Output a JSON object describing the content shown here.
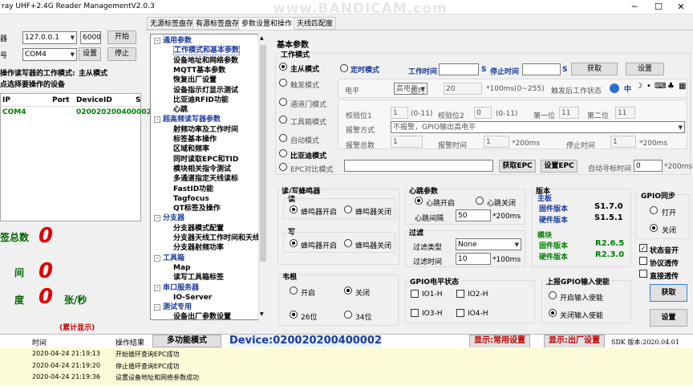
{
  "window": {
    "title": "ray UHF+2.4G Reader ManagementV2.0.3",
    "watermark": "www.BANDICAM.com"
  },
  "left": {
    "ip_label": "器",
    "ip_value": "127.0.0.1",
    "port_value": "6000",
    "start_btn": "开始",
    "com_label": "号",
    "com_value": "COM4",
    "set_btn": "设置",
    "stop_btn": "停止",
    "mode_label": "操作读写器的工作模式:",
    "mode_value": "主从模式",
    "select_hint": "点选择要操作的设备",
    "table_headers": [
      "IP",
      "Port",
      "DeviceID",
      "S"
    ],
    "table_rows": [
      [
        "COM4",
        "",
        "020020200400002",
        ""
      ]
    ],
    "count_label": "签总数",
    "count_value": "0",
    "time_label": "间",
    "time_value": "0",
    "speed_label": "度",
    "speed_value": "0",
    "speed_unit": "张/秒",
    "accum": "(累计显示)"
  },
  "tabs": [
    "无源标签盘存",
    "有源标签盘存",
    "参数设置和操作",
    "天线匹配度"
  ],
  "tree": [
    {
      "t": "通用参数",
      "k": "cat"
    },
    {
      "t": "工作模式和基本参数",
      "k": "sel"
    },
    {
      "t": "设备地址和网络参数",
      "k": "leaf"
    },
    {
      "t": "MQTT基本参数",
      "k": "leaf"
    },
    {
      "t": "恢复出厂设置",
      "k": "leaf"
    },
    {
      "t": "设备指示灯显示测试",
      "k": "leaf"
    },
    {
      "t": "比亚迪RFID功能",
      "k": "leaf"
    },
    {
      "t": "心跳",
      "k": "leaf"
    },
    {
      "t": "超高频读写器参数",
      "k": "cat"
    },
    {
      "t": "射频功率及工作时间",
      "k": "leaf"
    },
    {
      "t": "标签基本操作",
      "k": "leaf"
    },
    {
      "t": "区域和频率",
      "k": "leaf"
    },
    {
      "t": "同时读取EPC和TID",
      "k": "leaf"
    },
    {
      "t": "模块相关指令测试",
      "k": "leaf"
    },
    {
      "t": "多通道指定天线读标",
      "k": "leaf"
    },
    {
      "t": "FastID功能",
      "k": "leaf"
    },
    {
      "t": "Tagfocus",
      "k": "leaf"
    },
    {
      "t": "QT标签及操作",
      "k": "leaf"
    },
    {
      "t": "分支器",
      "k": "cat"
    },
    {
      "t": "分支器模式配置",
      "k": "leaf"
    },
    {
      "t": "分支器天线工作时间和天线",
      "k": "leaf"
    },
    {
      "t": "分支器射频功率",
      "k": "leaf"
    },
    {
      "t": "工具箱",
      "k": "cat"
    },
    {
      "t": "Map",
      "k": "leaf"
    },
    {
      "t": "读写工具箱标签",
      "k": "leaf"
    },
    {
      "t": "串口服务器",
      "k": "cat"
    },
    {
      "t": "IO-Server",
      "k": "leaf"
    },
    {
      "t": "测试专用",
      "k": "cat"
    },
    {
      "t": "设备出厂参数设置",
      "k": "leaf"
    }
  ],
  "basic": {
    "title": "基本参数",
    "workmode": "工作模式",
    "modes": [
      "主从模式",
      "触发模式",
      "通道门模式",
      "工具箱模式",
      "自动模式",
      "比亚迪模式",
      "EPC对比模式"
    ],
    "timed": "定时模式",
    "worktime": "工作时间",
    "s1": "S",
    "stoptime": "停止时间",
    "s2": "S",
    "get_btn": "获取",
    "set_btn": "设置",
    "level_label": "电平",
    "level_value": "高电平",
    "timeout_label": "超时",
    "timeout_value": "20",
    "timeout_unit": "*100ms(0~255)",
    "after_trigger": "触发后工作状态",
    "icons_text": "中",
    "check1_label": "校验位1",
    "check1_value": "1",
    "range1": "(0-11)",
    "check2_label": "校验位2",
    "check2_value": "0",
    "range2": "(0-11)",
    "first_label": "第一位",
    "first_value": "11",
    "second_label": "第二位",
    "second_value": "11",
    "alarm_label": "报警方式",
    "alarm_value": "不报警，GPIO输出高电平",
    "alarm_total_label": "报警总数",
    "alarm_total": "1",
    "alarm_time_label": "报警时间",
    "alarm_time": "1",
    "alarm_unit": "*200ms",
    "stop_time_label": "停止时间",
    "stop_time": "1",
    "stop_unit": "*200ms",
    "get_epc": "获取EPC",
    "set_epc": "设置EPC",
    "auto_clear": "自动寻标时间",
    "auto_clear_value": "0",
    "auto_unit": "*200ms"
  },
  "buzzer": {
    "title": "读/写蜂鸣器",
    "read": "读",
    "on": "蜂鸣器开启",
    "off": "蜂鸣器关闭",
    "write": "写",
    "won": "蜂鸣器开启",
    "woff": "蜂鸣器关闭"
  },
  "heart": {
    "title": "心跳参数",
    "on": "心跳开启",
    "off": "心跳关闭",
    "interval_label": "心跳间隔",
    "interval": "50",
    "unit": "*200ms"
  },
  "filter": {
    "title": "过滤",
    "type_label": "过滤类型",
    "type_value": "None",
    "time_label": "过滤时间",
    "time": "10",
    "unit": "*100ms"
  },
  "version": {
    "title": "版本",
    "main": "主板",
    "fw_l": "固件版本",
    "fw_v": "S1.7.0",
    "hw_l": "硬件版本",
    "hw_v": "S1.5.1",
    "mod": "模块",
    "mfw_l": "固件版本",
    "mfw_v": "R2.6.5",
    "mhw_l": "硬件版本",
    "mhw_v": "R2.3.0"
  },
  "gpio": {
    "title": "GPIO同步",
    "on": "打开",
    "off": "关闭"
  },
  "checks": [
    "状态音开",
    "协议透传",
    "直接透传"
  ],
  "right_get": "获取",
  "right_set": "设置",
  "wiegand": {
    "title": "韦根",
    "on": "开启",
    "off": "关闭",
    "b26": "26位",
    "b34": "34位"
  },
  "gpio_state": {
    "title": "GPIO电平状态",
    "io1": "IO1-H",
    "io2": "IO2-H",
    "io3": "IO3-H",
    "io4": "IO4-H"
  },
  "gpio_in": {
    "title": "上报GPIO输入使能",
    "on": "开启输入使能",
    "off": "关闭输入使能"
  },
  "bottom": {
    "col_time": "时间",
    "col_result": "操作结果",
    "multi_btn": "多功能模式",
    "device": "Device:020020200400002",
    "show_common": "显示:常用设置",
    "show_factory": "显示:出厂设置",
    "sdk": "SDK 版本:2020.04.01",
    "logs": [
      [
        "2020-04-24 21:19:13",
        "开始循环查询EPC成功"
      ],
      [
        "2020-04-24 21:19:20",
        "停止循环查询EPC成功"
      ],
      [
        "2020-04-24 21:19:36",
        "设置设备地址和网络参数成功"
      ]
    ]
  }
}
